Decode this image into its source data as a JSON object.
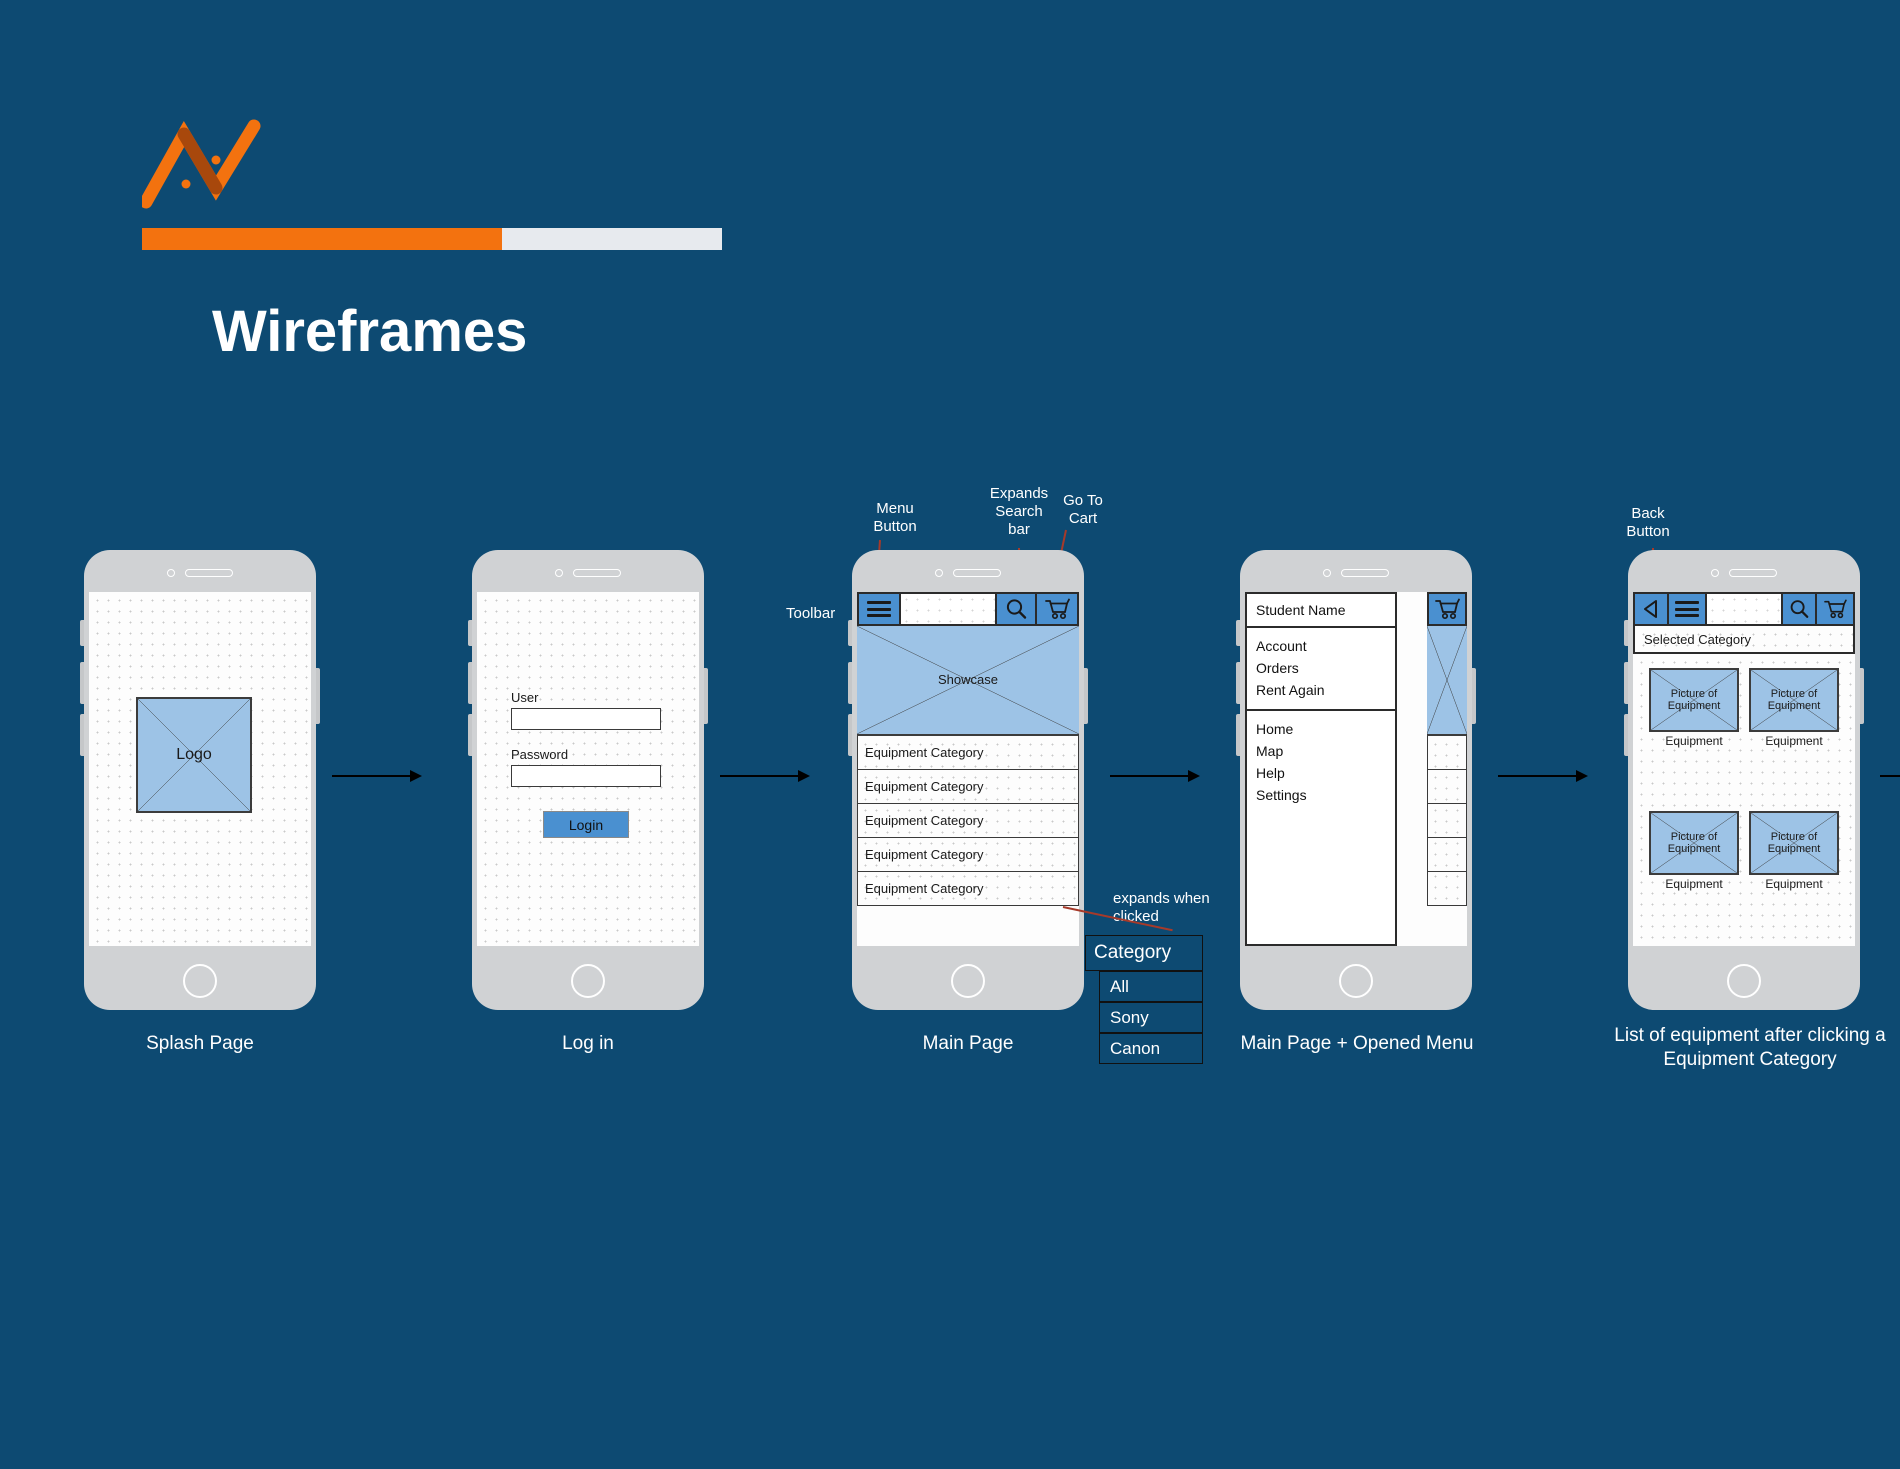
{
  "slide": {
    "title": "Wireframes",
    "background_color": "#0d4a72",
    "accent_color": "#f3720f",
    "progress_track_color": "#e7eaee"
  },
  "logo": {
    "name": "zigzag-logo",
    "color": "#f3720f"
  },
  "screens": [
    {
      "id": "splash",
      "caption": "Splash Page",
      "logo_placeholder": "Logo"
    },
    {
      "id": "login",
      "caption": "Log in",
      "user_label": "User",
      "user_value": "",
      "password_label": "Password",
      "password_value": "",
      "login_button": "Login"
    },
    {
      "id": "main",
      "caption": "Main Page",
      "toolbar_label": "Toolbar",
      "search_value": "",
      "showcase_label": "Showcase",
      "categories": [
        "Equipment Category",
        "Equipment Category",
        "Equipment Category",
        "Equipment Category",
        "Equipment Category"
      ]
    },
    {
      "id": "menu",
      "caption": "Main Page + Opened Menu",
      "student_name": "Student Name",
      "group_one": [
        "Account",
        "Orders",
        "Rent Again"
      ],
      "group_two": [
        "Home",
        "Map",
        "Help",
        "Settings"
      ]
    },
    {
      "id": "equipment-list",
      "caption": "List of equipment after clicking a Equipment Category",
      "selected_category": "Selected Category",
      "items": [
        {
          "placeholder": "Picture of Equipment",
          "name": "Equipment"
        },
        {
          "placeholder": "Picture of Equipment",
          "name": "Equipment"
        },
        {
          "placeholder": "Picture of Equipment",
          "name": "Equipment"
        },
        {
          "placeholder": "Picture of Equipment",
          "name": "Equipment"
        }
      ]
    }
  ],
  "annotations": {
    "menu_button": "Menu\nButton",
    "menu_button_l1": "Menu",
    "menu_button_l2": "Button",
    "expands_search_l1": "Expands",
    "expands_search_l2": "Search",
    "expands_search_l3": "bar",
    "go_to_cart_l1": "Go To",
    "go_to_cart_l2": "Cart",
    "toolbar": "Toolbar",
    "expands_when_clicked_l1": "expands when",
    "expands_when_clicked_l2": "clicked",
    "back_button_l1": "Back",
    "back_button_l2": "Button"
  },
  "dropdown": {
    "header": "Category",
    "options": [
      "All",
      "Sony",
      "Canon"
    ]
  },
  "icons": {
    "hamburger": "hamburger-menu-icon",
    "search": "search-icon",
    "cart": "shopping-cart-icon",
    "back": "back-arrow-icon"
  }
}
